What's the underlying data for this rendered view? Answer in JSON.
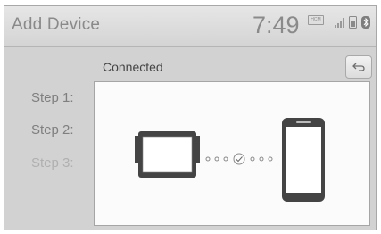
{
  "header": {
    "title": "Add Device",
    "time": "7:49",
    "badge_text": "HCM",
    "icons": [
      "signal-icon",
      "phone-battery-icon",
      "bluetooth-icon"
    ]
  },
  "status": {
    "text": "Connected"
  },
  "steps": [
    {
      "label": "Step 1:",
      "active": false
    },
    {
      "label": "Step 2:",
      "active": false
    },
    {
      "label": "Step 3:",
      "active": true
    }
  ],
  "back_button": {
    "icon": "back-arrow-icon"
  },
  "diagram": {
    "devices": [
      "head-unit-icon",
      "smartphone-icon"
    ],
    "link_state": "connected-check"
  }
}
